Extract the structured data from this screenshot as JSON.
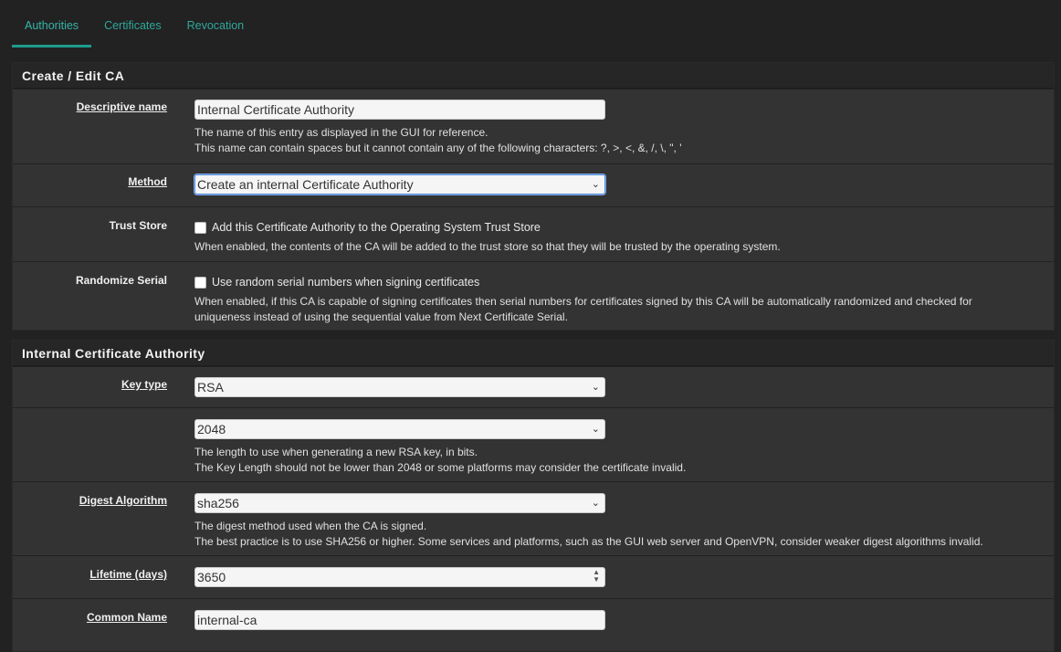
{
  "tabs": [
    "Authorities",
    "Certificates",
    "Revocation"
  ],
  "panel1": {
    "title": "Create / Edit CA",
    "descriptive_name": {
      "label": "Descriptive name",
      "value": "Internal Certificate Authority",
      "help1": "The name of this entry as displayed in the GUI for reference.",
      "help2": "This name can contain spaces but it cannot contain any of the following characters: ?, >, <, &, /, \\, \", '"
    },
    "method": {
      "label": "Method",
      "value": "Create an internal Certificate Authority"
    },
    "trust_store": {
      "label": "Trust Store",
      "checkbox_label": "Add this Certificate Authority to the Operating System Trust Store",
      "checked": false,
      "help": "When enabled, the contents of the CA will be added to the trust store so that they will be trusted by the operating system."
    },
    "randomize_serial": {
      "label": "Randomize Serial",
      "checkbox_label": "Use random serial numbers when signing certificates",
      "checked": false,
      "help1": "When enabled, if this CA is capable of signing certificates then serial numbers for certificates signed by this CA will be automatically randomized and checked for",
      "help2": "uniqueness instead of using the sequential value from Next Certificate Serial."
    }
  },
  "panel2": {
    "title": "Internal Certificate Authority",
    "key_type": {
      "label": "Key type",
      "value": "RSA"
    },
    "key_length": {
      "value": "2048",
      "help1": "The length to use when generating a new RSA key, in bits.",
      "help2": "The Key Length should not be lower than 2048 or some platforms may consider the certificate invalid."
    },
    "digest": {
      "label": "Digest Algorithm",
      "value": "sha256",
      "help1": "The digest method used when the CA is signed.",
      "help2": "The best practice is to use SHA256 or higher. Some services and platforms, such as the GUI web server and OpenVPN, consider weaker digest algorithms invalid."
    },
    "lifetime": {
      "label": "Lifetime (days)",
      "value": "3650"
    },
    "common_name": {
      "label": "Common Name",
      "value": "internal-ca"
    }
  }
}
